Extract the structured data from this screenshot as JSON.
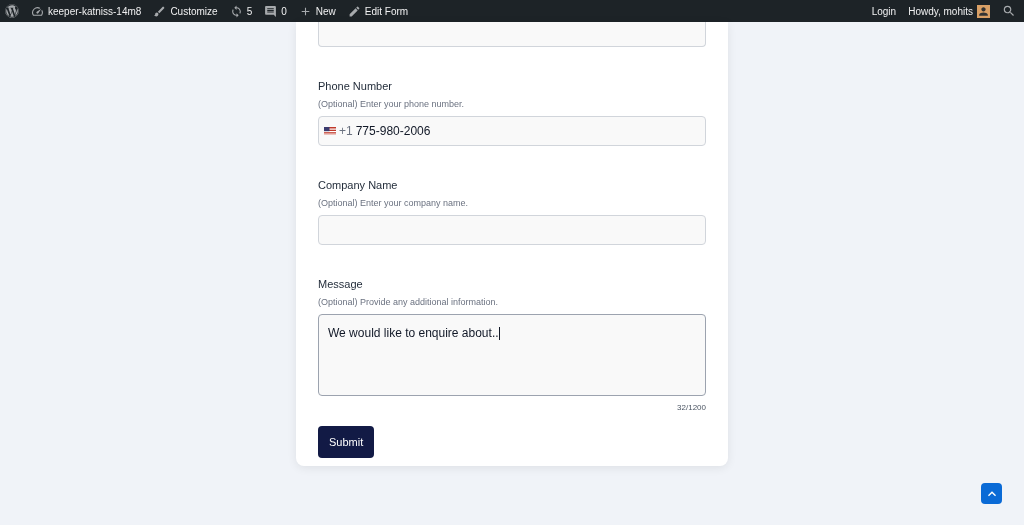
{
  "admin_bar": {
    "site": "keeper-katniss-14m8",
    "customize": "Customize",
    "updates": "5",
    "comments": "0",
    "new": "New",
    "edit": "Edit Form",
    "login": "Login",
    "greeting": "Howdy, mohits"
  },
  "form": {
    "fields": [
      {
        "kind": "phone",
        "label": "Phone Number",
        "hint": "(Optional) Enter your phone number.",
        "prefix": "+1",
        "value": "775-980-2006"
      },
      {
        "kind": "text",
        "label": "Company Name",
        "hint": "(Optional) Enter your company name."
      },
      {
        "kind": "textarea",
        "label": "Message",
        "hint": "(Optional) Provide any additional information.",
        "value": "We would like to enquire about..",
        "counter": "32/1200"
      }
    ],
    "submit": "Submit"
  }
}
